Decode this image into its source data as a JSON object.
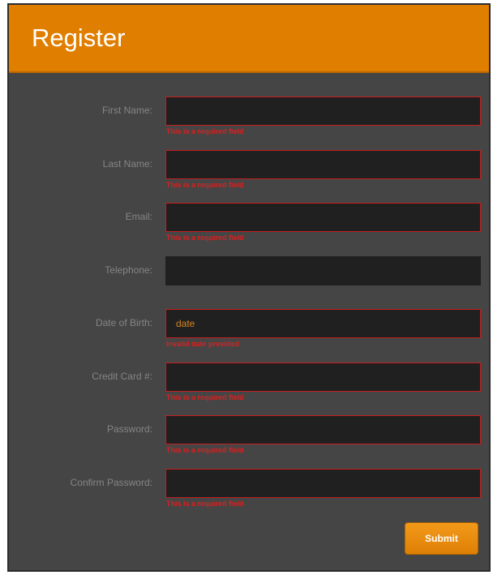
{
  "header": {
    "title": "Register"
  },
  "fields": [
    {
      "label": "First Name:",
      "value": "",
      "error": "This is a required field"
    },
    {
      "label": "Last Name:",
      "value": "",
      "error": "This is a required field"
    },
    {
      "label": "Email:",
      "value": "",
      "error": "This is a required field"
    },
    {
      "label": "Telephone:",
      "value": "",
      "error": ""
    },
    {
      "label": "Date of Birth:",
      "value": "date",
      "error": "Invalid date provided"
    },
    {
      "label": "Credit Card #:",
      "value": "",
      "error": "This is a required field"
    },
    {
      "label": "Password:",
      "value": "",
      "error": "This is a required field"
    },
    {
      "label": "Confirm Password:",
      "value": "",
      "error": "This is a required field"
    }
  ],
  "submit": {
    "label": "Submit"
  },
  "colors": {
    "accent": "#e07e00",
    "error": "#d9201f",
    "panel": "#454545",
    "input": "#202020"
  }
}
